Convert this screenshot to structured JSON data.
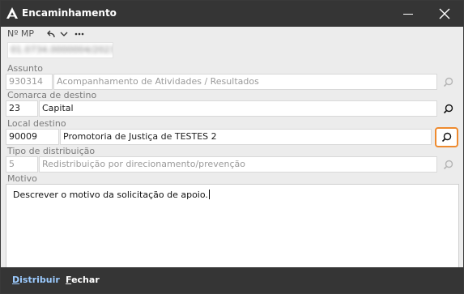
{
  "window": {
    "title": "Encaminhamento"
  },
  "header": {
    "mp_label": "Nº MP",
    "mp_value": "01.0734.0000004/2023"
  },
  "assunto": {
    "label": "Assunto",
    "code": "930314",
    "description": "Acompanhamento de Atividades / Resultados"
  },
  "comarca": {
    "label": "Comarca de destino",
    "code": "23",
    "description": "Capital"
  },
  "local": {
    "label": "Local destino",
    "code": "90009",
    "description": "Promotoria de Justiça de TESTES 2"
  },
  "tipo": {
    "label": "Tipo de distribuição",
    "code": "5",
    "description": "Redistribuição por direcionamento/prevenção"
  },
  "motivo": {
    "label": "Motivo",
    "value": "Descrever o motivo da solicitação de apoio."
  },
  "footer": {
    "distribuir_mnemonic": "D",
    "distribuir_rest": "istribuir",
    "fechar_mnemonic": "F",
    "fechar_rest": "echar"
  },
  "colors": {
    "titlebar": "#353535",
    "focus": "#ee8a2e",
    "link": "#9ccbff"
  }
}
